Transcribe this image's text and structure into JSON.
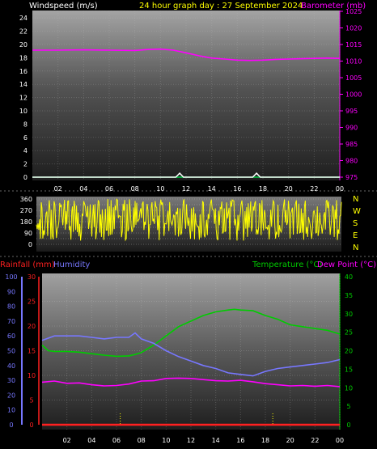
{
  "header": {
    "left": "Windspeed (m/s)",
    "center": "24 hour graph day : 27 September 2024",
    "right": "Barometer (mb)"
  },
  "colors": {
    "wind": "#ffffff",
    "windGust": "#e0e0e0",
    "baro": "#ff00ff",
    "dir": "#ffff00",
    "temp": "#00cc00",
    "dew": "#ff00ff",
    "hum": "#7777ff",
    "rain": "#ff2020",
    "title": "#ffff00",
    "leftAxis": "#ffffff",
    "rightAxis": "#ff00ff"
  },
  "timeTicks": [
    "02",
    "04",
    "06",
    "08",
    "10",
    "12",
    "14",
    "16",
    "18",
    "20",
    "22",
    "00"
  ],
  "dirLabels": [
    "N",
    "W",
    "S",
    "E",
    "N"
  ],
  "lowerHeader": {
    "rain": "Rainfall (mm)",
    "humidity": "Humidity",
    "temp": "Temperature (°C)",
    "dew": "Dew Point (°C)"
  },
  "chart_data": [
    {
      "type": "line",
      "title": "24 hour graph day : 27 September 2024",
      "ylabel": "Windspeed (m/s)",
      "y2label": "Barometer (mb)",
      "x_range_hours": [
        0,
        24
      ],
      "ylim": [
        0,
        25
      ],
      "y2lim": [
        975,
        1025
      ],
      "y_ticks": [
        0,
        2,
        4,
        6,
        8,
        10,
        12,
        14,
        16,
        18,
        20,
        22,
        24
      ],
      "y2_ticks": [
        975,
        980,
        985,
        990,
        995,
        1000,
        1005,
        1010,
        1015,
        1020,
        1025
      ],
      "series": [
        {
          "name": "Barometer (mb)",
          "axis": "right",
          "x": [
            0,
            2,
            4,
            6,
            8,
            9,
            10,
            11,
            12,
            13,
            14,
            15,
            16,
            17,
            18,
            19,
            20,
            21,
            22,
            23,
            24
          ],
          "y": [
            1013.3,
            1013.3,
            1013.4,
            1013.3,
            1013.2,
            1013.5,
            1013.6,
            1013.3,
            1012.5,
            1011.6,
            1010.9,
            1010.6,
            1010.3,
            1010.2,
            1010.3,
            1010.5,
            1010.6,
            1010.7,
            1010.8,
            1010.9,
            1010.8
          ]
        },
        {
          "name": "Windspeed (m/s)",
          "axis": "left",
          "x": [
            0,
            4,
            8,
            11.2,
            11.5,
            11.8,
            14,
            17.2,
            17.5,
            17.8,
            20,
            24
          ],
          "y": [
            0,
            0,
            0,
            0,
            0.6,
            0,
            0,
            0,
            0.6,
            0,
            0,
            0
          ]
        }
      ]
    },
    {
      "type": "scatter",
      "ylabel": "Wind direction",
      "ylim": [
        0,
        360
      ],
      "y_ticks": [
        0,
        45,
        90,
        135,
        180,
        225,
        270,
        315,
        360
      ],
      "note": "dense variable direction trace across the 24 hours, mostly between 45 and 360 degrees"
    },
    {
      "type": "line",
      "ylabel": "Humidity",
      "y_ticks_humidity": [
        0,
        10,
        20,
        30,
        40,
        50,
        60,
        70,
        80,
        90,
        100
      ],
      "y_ticks_rain": [
        0,
        5,
        10,
        15,
        20,
        25,
        30
      ],
      "y_ticks_temp": [
        0,
        5,
        10,
        15,
        20,
        25,
        30,
        35,
        40
      ],
      "ylim": [
        0,
        100
      ],
      "rainlim": [
        0,
        30
      ],
      "templim": [
        0,
        40
      ],
      "series": [
        {
          "name": "Temperature (°C)",
          "axis": "temp",
          "x": [
            0,
            0.5,
            1,
            2,
            3,
            4,
            5,
            6,
            7,
            7.5,
            8,
            9,
            10,
            11,
            12,
            13,
            14,
            15,
            15.5,
            16,
            17,
            18,
            19,
            20,
            21,
            22,
            23,
            24
          ],
          "y": [
            21.5,
            20,
            19.8,
            19.8,
            19.6,
            19.2,
            18.8,
            18.5,
            18.6,
            19,
            19.5,
            21.5,
            24,
            26.5,
            28,
            29.5,
            30.5,
            31,
            31.2,
            31,
            30.8,
            29.5,
            28.5,
            27,
            26.5,
            26,
            25.5,
            24.5
          ]
        },
        {
          "name": "Humidity",
          "axis": "humidity",
          "x": [
            0,
            1,
            2,
            3,
            4,
            5,
            6,
            7,
            7.5,
            8,
            9,
            10,
            11,
            12,
            13,
            14,
            15,
            16,
            17,
            18,
            19,
            20,
            21,
            22,
            23,
            24
          ],
          "y": [
            57,
            60,
            60,
            60,
            59,
            58,
            59,
            59,
            62,
            58,
            55,
            50,
            46,
            43,
            40,
            38,
            35,
            34,
            33,
            36,
            38,
            39,
            40,
            41,
            42,
            44
          ]
        },
        {
          "name": "Dew Point (°C)",
          "axis": "temp",
          "x": [
            0,
            1,
            2,
            3,
            4,
            5,
            6,
            7,
            8,
            9,
            10,
            11,
            12,
            13,
            14,
            15,
            16,
            17,
            18,
            19,
            20,
            21,
            22,
            23,
            24
          ],
          "y": [
            11.5,
            11.8,
            11.2,
            11.3,
            10.8,
            10.5,
            10.6,
            11,
            11.8,
            11.9,
            12.5,
            12.6,
            12.5,
            12.2,
            11.9,
            11.8,
            12,
            11.6,
            11.1,
            10.8,
            10.5,
            10.6,
            10.4,
            10.6,
            10.3
          ]
        },
        {
          "name": "Rainfall (mm)",
          "axis": "rain",
          "x": [
            0,
            24
          ],
          "y": [
            0,
            0
          ]
        }
      ]
    }
  ]
}
